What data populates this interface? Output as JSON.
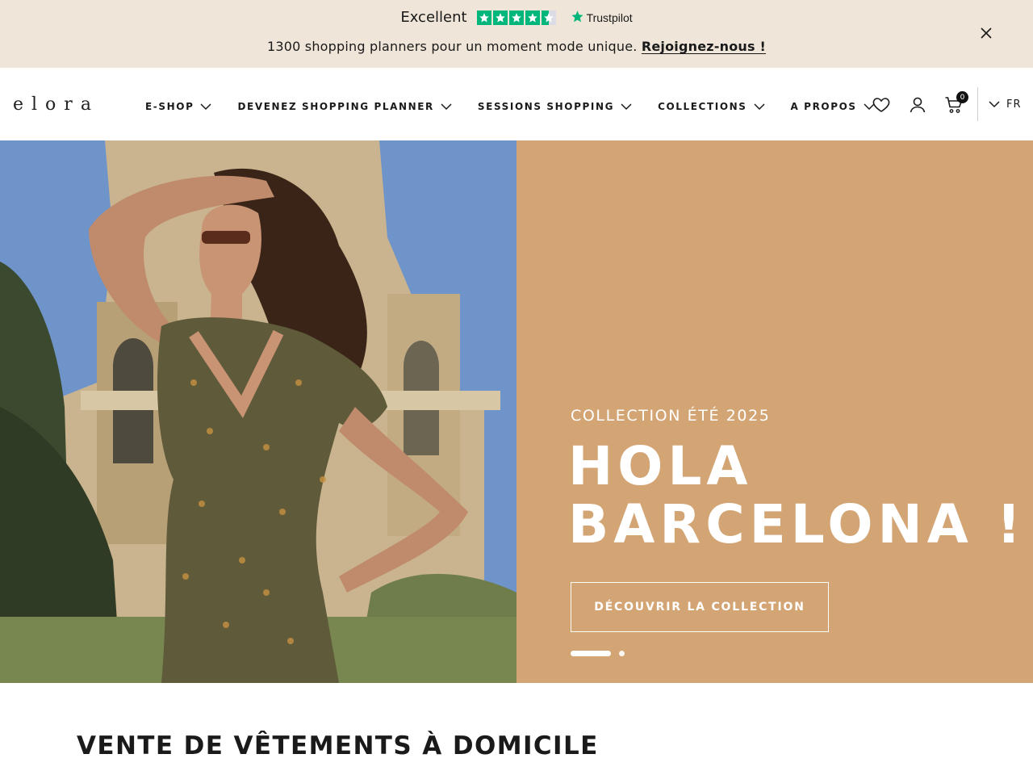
{
  "topbar": {
    "trustpilot": {
      "rating_label": "Excellent",
      "brand": "Trustpilot",
      "stars": 4.5
    },
    "announcement_text": "1300 shopping planners pour un moment mode unique.",
    "announcement_link": "Rejoignez-nous !"
  },
  "header": {
    "logo": "elora",
    "nav": [
      {
        "label": "E-SHOP"
      },
      {
        "label": "DEVENEZ SHOPPING PLANNER"
      },
      {
        "label": "SESSIONS SHOPPING"
      },
      {
        "label": "COLLECTIONS"
      },
      {
        "label": "A PROPOS"
      }
    ],
    "cart_count": "0",
    "language": "FR"
  },
  "hero": {
    "kicker": "COLLECTION ÉTÉ 2025",
    "headline_line1": "HOLA",
    "headline_line2": "BARCELONA !",
    "cta": "DÉCOUVRIR LA COLLECTION",
    "slides_total": 2,
    "slide_active": 1
  },
  "section": {
    "title": "VENTE DE VÊTEMENTS À DOMICILE"
  },
  "colors": {
    "topbar_bg": "#efe6d9",
    "hero_panel": "#d4a574",
    "trustpilot_green": "#00b67a"
  }
}
